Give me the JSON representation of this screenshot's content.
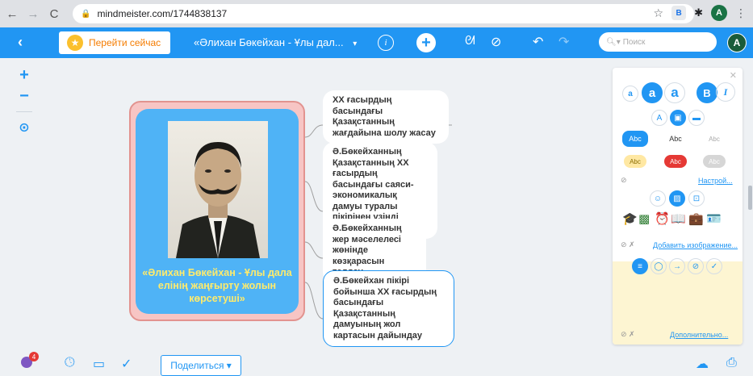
{
  "browser": {
    "url": "mindmeister.com/1744838137",
    "avatar_letter": "A",
    "ext_letter": "B"
  },
  "toolbar": {
    "goto_label": "Перейти сейчас",
    "map_title": "«Әлихан Бөкейхан - Ұлы дал...",
    "title_caret": "▾",
    "info_glyph": "i",
    "add_glyph": "+",
    "search_placeholder": "Поиск",
    "avatar_letter": "A"
  },
  "map": {
    "central_topic": "«Әлихан Бөкейхан - Ұлы дала елінің жаңғырту жолын көрсетуші»",
    "topics": [
      {
        "text": "ХХ ғасырдың басындағы Қазақстанның жағдайына шолу жасау"
      },
      {
        "text": "Ә.Бөкейханның Қазақстанның ХХ ғасырдың басындағы саяси-экономикалық дамуы туралы пікірінен үзінді келтіру"
      },
      {
        "text": "Ә.Бөкейханның жер мәселелесі жөнінде көзқарасын талдау"
      },
      {
        "text": "Ә.Бөкейхан пікірі бойынша ХХ ғасырдың басындағы Қазақстанның дамуының жол картасын дайындау"
      }
    ]
  },
  "format_panel": {
    "size_labels": [
      "a",
      "a",
      "a"
    ],
    "bold_label": "B",
    "italic_label": "I",
    "style_labels": [
      "Abc",
      "Abc",
      "Abc"
    ],
    "chip_labels": [
      "Abc",
      "Abc",
      "Abc"
    ],
    "settings_link": "Настрой...",
    "add_image_link": "Добавить изображение...",
    "more_link": "Дополнительно..."
  },
  "bottom_bar": {
    "notifications_count": "4",
    "share_label": "Поделиться ▾"
  },
  "colors": {
    "accent": "#2196f3",
    "central_fill": "#4fb3f6",
    "central_text": "#ffeb6b",
    "frame_fill": "#f7c5c4"
  }
}
